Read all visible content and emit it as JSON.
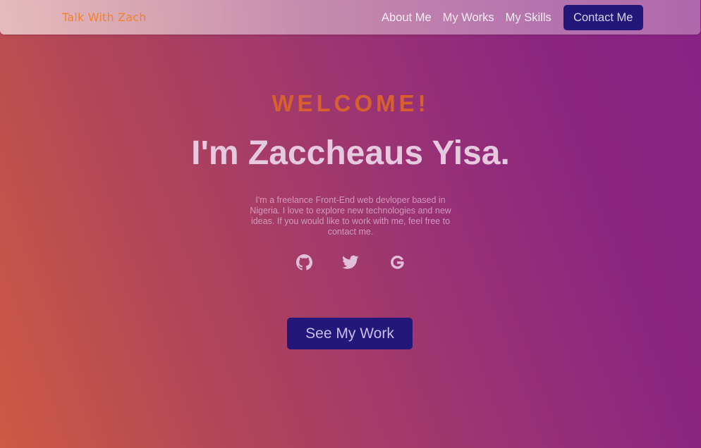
{
  "navbar": {
    "brand": "Talk With Zach",
    "links": [
      {
        "label": "About Me"
      },
      {
        "label": "My Works"
      },
      {
        "label": "My Skills"
      }
    ],
    "contact_label": "Contact Me"
  },
  "hero": {
    "greeting": "WELCOME!",
    "title": "I'm Zaccheaus Yisa.",
    "bio": "I'm a freelance Front-End web devloper based in Nigeria. I love to explore new technologies and new ideas. If you would like to work with me, feel free to contact me.",
    "socials": [
      {
        "icon": "github-icon"
      },
      {
        "icon": "twitter-icon"
      },
      {
        "icon": "google-icon"
      }
    ],
    "cta_label": "See My Work"
  },
  "colors": {
    "brand_text": "#f0822e",
    "greeting": "#d6612f",
    "button_bg": "#24177a",
    "gradient_start": "#cd5a44",
    "gradient_end": "#8a2284"
  }
}
